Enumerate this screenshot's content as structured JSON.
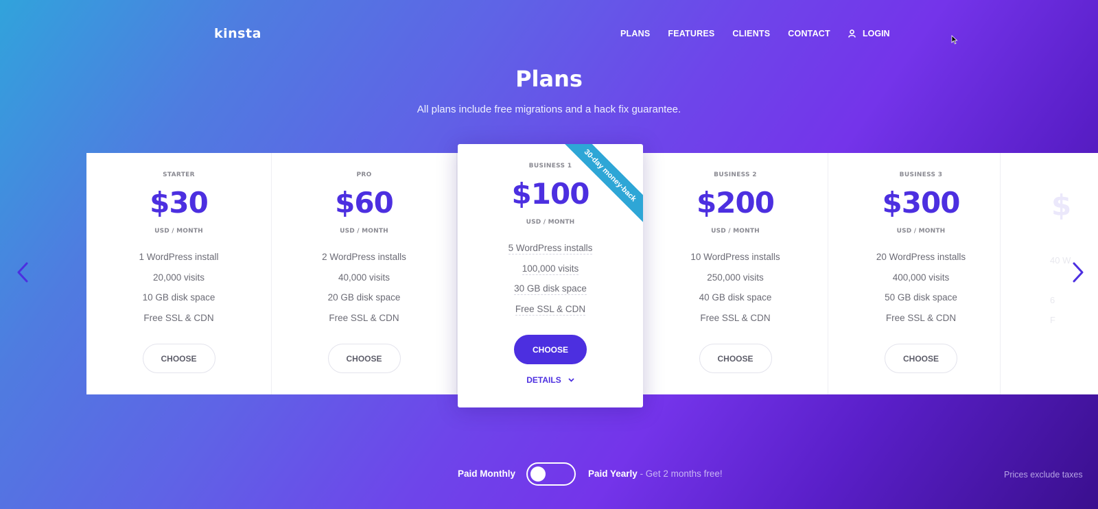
{
  "header": {
    "logo": "kinsta",
    "nav": [
      {
        "label": "PLANS"
      },
      {
        "label": "FEATURES"
      },
      {
        "label": "CLIENTS"
      },
      {
        "label": "CONTACT"
      }
    ],
    "login_label": "LOGIN",
    "login_icon": "user-icon"
  },
  "hero": {
    "title": "Plans",
    "subtitle": "All plans include free migrations and a hack fix guarantee."
  },
  "plans": [
    {
      "name": "STARTER",
      "price": "$30",
      "period": "USD / MONTH",
      "features": [
        "1 WordPress install",
        "20,000 visits",
        "10 GB disk space",
        "Free SSL & CDN"
      ],
      "button": "CHOOSE"
    },
    {
      "name": "PRO",
      "price": "$60",
      "period": "USD / MONTH",
      "features": [
        "2 WordPress installs",
        "40,000 visits",
        "20 GB disk space",
        "Free SSL & CDN"
      ],
      "button": "CHOOSE"
    },
    {
      "name": "BUSINESS 1",
      "price": "$100",
      "period": "USD / MONTH",
      "features": [
        "5 WordPress installs",
        "100,000 visits",
        "30 GB disk space",
        "Free SSL & CDN"
      ],
      "button": "CHOOSE",
      "details": "DETAILS",
      "ribbon": "30-day money-back",
      "featured": true
    },
    {
      "name": "BUSINESS 2",
      "price": "$200",
      "period": "USD / MONTH",
      "features": [
        "10 WordPress installs",
        "250,000 visits",
        "40 GB disk space",
        "Free SSL & CDN"
      ],
      "button": "CHOOSE"
    },
    {
      "name": "BUSINESS 3",
      "price": "$300",
      "period": "USD / MONTH",
      "features": [
        "20 WordPress installs",
        "400,000 visits",
        "50 GB disk space",
        "Free SSL & CDN"
      ],
      "button": "CHOOSE"
    }
  ],
  "partial_plan": {
    "price": "$",
    "feature1": "40 W",
    "feature3": "6",
    "feature4": "F"
  },
  "carousel": {
    "prev_icon": "chevron-left-icon",
    "next_icon": "chevron-right-icon"
  },
  "billing": {
    "monthly_label": "Paid Monthly",
    "yearly_label": "Paid Yearly",
    "yearly_promo": " - Get 2 months free!",
    "selected": "monthly"
  },
  "footer_note": "Prices exclude taxes",
  "colors": {
    "accent": "#4c2fe0",
    "ribbon": "#2ea6d6",
    "gradient_start": "#31a3dc",
    "gradient_end": "#3a0f8e"
  }
}
